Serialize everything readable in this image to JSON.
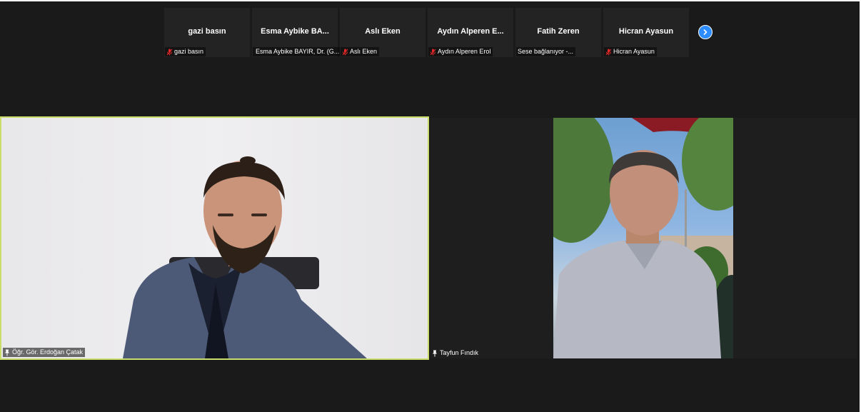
{
  "gallery_strip": {
    "participants": [
      {
        "display_name": "gazi basın",
        "label": "gazi basın",
        "muted": true
      },
      {
        "display_name": "Esma Aybike BA...",
        "label": "Esma Aybike BAYIR, Dr. (G...",
        "muted": true
      },
      {
        "display_name": "Aslı Eken",
        "label": "Aslı Eken",
        "muted": true
      },
      {
        "display_name": "Aydın Alperen E...",
        "label": "Aydın Alperen Erol",
        "muted": true
      },
      {
        "display_name": "Fatih Zeren",
        "label": "Sese bağlanıyor -...",
        "muted": false
      },
      {
        "display_name": "Hicran Ayasun",
        "label": "Hicran Ayasun",
        "muted": true
      }
    ],
    "next_icon": "chevron-right-icon"
  },
  "main_videos": [
    {
      "name": "Öğr. Gör. Erdoğan Çatak",
      "active_speaker": true,
      "pin_icon": "pin-icon"
    },
    {
      "name": "Tayfun Fındık",
      "active_speaker": false,
      "pin_icon": "pin-icon"
    }
  ],
  "colors": {
    "background": "#1a1a1a",
    "tile_background": "#232323",
    "active_speaker_border": "#c9dd6a",
    "next_button": "#2d8cff",
    "muted_icon": "#e02828"
  }
}
